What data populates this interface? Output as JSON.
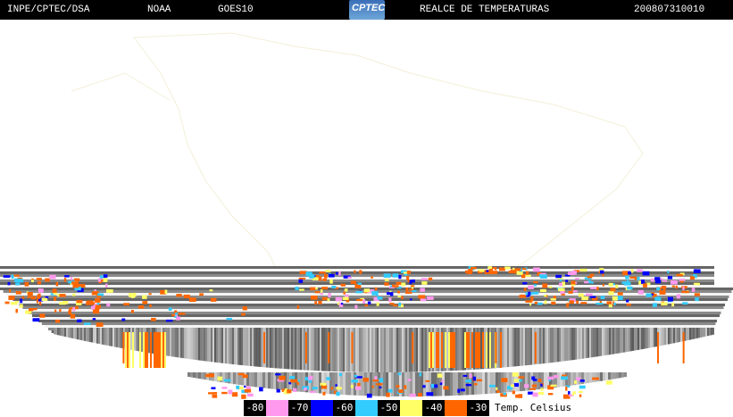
{
  "header": {
    "institution": "INPE/CPTEC/DSA",
    "agency": "NOAA",
    "satellite": "GOES10",
    "logo_text": "CPTEC",
    "product": "REALCE DE TEMPERATURAS",
    "timestamp": "200807310010"
  },
  "legend": {
    "entries": [
      {
        "label": "-80",
        "color": "#ff99ee"
      },
      {
        "label": "-70",
        "color": "#0000ff"
      },
      {
        "label": "-60",
        "color": "#33ccff"
      },
      {
        "label": "-50",
        "color": "#ffff66"
      },
      {
        "label": "-40",
        "color": "#ff6600"
      },
      {
        "label": "-30",
        "color": null
      }
    ],
    "unit": "Temp. Celsius"
  }
}
